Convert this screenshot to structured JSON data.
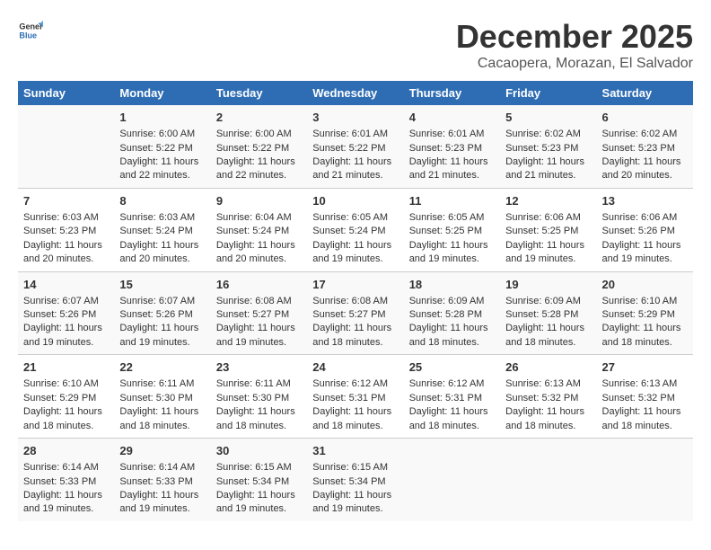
{
  "header": {
    "logo_general": "General",
    "logo_blue": "Blue",
    "month": "December 2025",
    "location": "Cacaopera, Morazan, El Salvador"
  },
  "weekdays": [
    "Sunday",
    "Monday",
    "Tuesday",
    "Wednesday",
    "Thursday",
    "Friday",
    "Saturday"
  ],
  "weeks": [
    [
      {
        "day": "",
        "content": ""
      },
      {
        "day": "1",
        "content": "Sunrise: 6:00 AM\nSunset: 5:22 PM\nDaylight: 11 hours\nand 22 minutes."
      },
      {
        "day": "2",
        "content": "Sunrise: 6:00 AM\nSunset: 5:22 PM\nDaylight: 11 hours\nand 22 minutes."
      },
      {
        "day": "3",
        "content": "Sunrise: 6:01 AM\nSunset: 5:22 PM\nDaylight: 11 hours\nand 21 minutes."
      },
      {
        "day": "4",
        "content": "Sunrise: 6:01 AM\nSunset: 5:23 PM\nDaylight: 11 hours\nand 21 minutes."
      },
      {
        "day": "5",
        "content": "Sunrise: 6:02 AM\nSunset: 5:23 PM\nDaylight: 11 hours\nand 21 minutes."
      },
      {
        "day": "6",
        "content": "Sunrise: 6:02 AM\nSunset: 5:23 PM\nDaylight: 11 hours\nand 20 minutes."
      }
    ],
    [
      {
        "day": "7",
        "content": "Sunrise: 6:03 AM\nSunset: 5:23 PM\nDaylight: 11 hours\nand 20 minutes."
      },
      {
        "day": "8",
        "content": "Sunrise: 6:03 AM\nSunset: 5:24 PM\nDaylight: 11 hours\nand 20 minutes."
      },
      {
        "day": "9",
        "content": "Sunrise: 6:04 AM\nSunset: 5:24 PM\nDaylight: 11 hours\nand 20 minutes."
      },
      {
        "day": "10",
        "content": "Sunrise: 6:05 AM\nSunset: 5:24 PM\nDaylight: 11 hours\nand 19 minutes."
      },
      {
        "day": "11",
        "content": "Sunrise: 6:05 AM\nSunset: 5:25 PM\nDaylight: 11 hours\nand 19 minutes."
      },
      {
        "day": "12",
        "content": "Sunrise: 6:06 AM\nSunset: 5:25 PM\nDaylight: 11 hours\nand 19 minutes."
      },
      {
        "day": "13",
        "content": "Sunrise: 6:06 AM\nSunset: 5:26 PM\nDaylight: 11 hours\nand 19 minutes."
      }
    ],
    [
      {
        "day": "14",
        "content": "Sunrise: 6:07 AM\nSunset: 5:26 PM\nDaylight: 11 hours\nand 19 minutes."
      },
      {
        "day": "15",
        "content": "Sunrise: 6:07 AM\nSunset: 5:26 PM\nDaylight: 11 hours\nand 19 minutes."
      },
      {
        "day": "16",
        "content": "Sunrise: 6:08 AM\nSunset: 5:27 PM\nDaylight: 11 hours\nand 19 minutes."
      },
      {
        "day": "17",
        "content": "Sunrise: 6:08 AM\nSunset: 5:27 PM\nDaylight: 11 hours\nand 18 minutes."
      },
      {
        "day": "18",
        "content": "Sunrise: 6:09 AM\nSunset: 5:28 PM\nDaylight: 11 hours\nand 18 minutes."
      },
      {
        "day": "19",
        "content": "Sunrise: 6:09 AM\nSunset: 5:28 PM\nDaylight: 11 hours\nand 18 minutes."
      },
      {
        "day": "20",
        "content": "Sunrise: 6:10 AM\nSunset: 5:29 PM\nDaylight: 11 hours\nand 18 minutes."
      }
    ],
    [
      {
        "day": "21",
        "content": "Sunrise: 6:10 AM\nSunset: 5:29 PM\nDaylight: 11 hours\nand 18 minutes."
      },
      {
        "day": "22",
        "content": "Sunrise: 6:11 AM\nSunset: 5:30 PM\nDaylight: 11 hours\nand 18 minutes."
      },
      {
        "day": "23",
        "content": "Sunrise: 6:11 AM\nSunset: 5:30 PM\nDaylight: 11 hours\nand 18 minutes."
      },
      {
        "day": "24",
        "content": "Sunrise: 6:12 AM\nSunset: 5:31 PM\nDaylight: 11 hours\nand 18 minutes."
      },
      {
        "day": "25",
        "content": "Sunrise: 6:12 AM\nSunset: 5:31 PM\nDaylight: 11 hours\nand 18 minutes."
      },
      {
        "day": "26",
        "content": "Sunrise: 6:13 AM\nSunset: 5:32 PM\nDaylight: 11 hours\nand 18 minutes."
      },
      {
        "day": "27",
        "content": "Sunrise: 6:13 AM\nSunset: 5:32 PM\nDaylight: 11 hours\nand 18 minutes."
      }
    ],
    [
      {
        "day": "28",
        "content": "Sunrise: 6:14 AM\nSunset: 5:33 PM\nDaylight: 11 hours\nand 19 minutes."
      },
      {
        "day": "29",
        "content": "Sunrise: 6:14 AM\nSunset: 5:33 PM\nDaylight: 11 hours\nand 19 minutes."
      },
      {
        "day": "30",
        "content": "Sunrise: 6:15 AM\nSunset: 5:34 PM\nDaylight: 11 hours\nand 19 minutes."
      },
      {
        "day": "31",
        "content": "Sunrise: 6:15 AM\nSunset: 5:34 PM\nDaylight: 11 hours\nand 19 minutes."
      },
      {
        "day": "",
        "content": ""
      },
      {
        "day": "",
        "content": ""
      },
      {
        "day": "",
        "content": ""
      }
    ]
  ]
}
